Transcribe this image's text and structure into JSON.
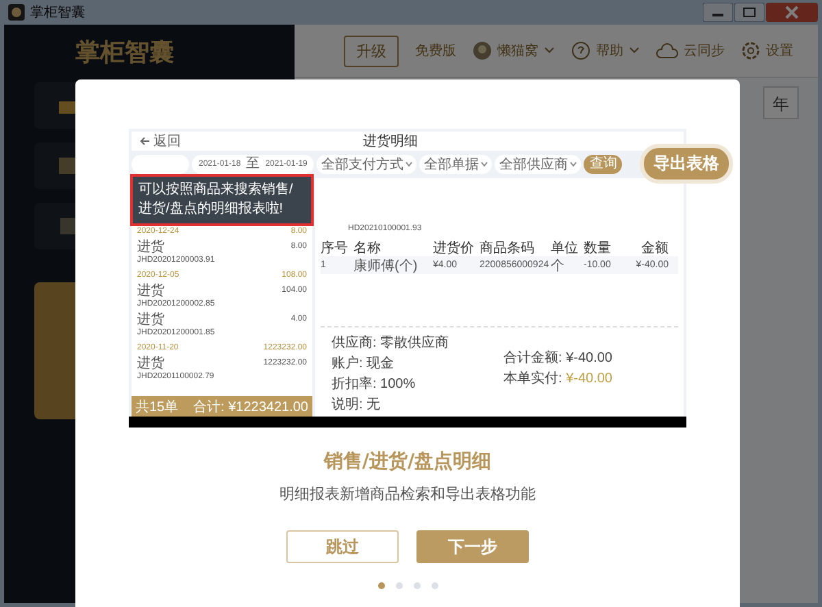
{
  "window": {
    "title": "掌柜智囊"
  },
  "header": {
    "upgrade": "升级",
    "edition": "免费版",
    "user": "懒猫窝",
    "help": "帮助",
    "sync": "云同步",
    "settings": "设置"
  },
  "background": {
    "logo": "掌柜智囊",
    "year_fragment": "年"
  },
  "dialog": {
    "preview": {
      "back": "返回",
      "title": "进货明细",
      "date_from": "2021-01-18",
      "date_sep": "至",
      "date_to": "2021-01-19",
      "filters": [
        "全部支付方式",
        "全部单据",
        "全部供应商"
      ],
      "query": "查询",
      "list": [
        {
          "kind": "date",
          "label": "2020-12-24",
          "amount": "8.00"
        },
        {
          "kind": "entry",
          "label": "进货",
          "amount": "8.00",
          "code": "JHD20201200003.91"
        },
        {
          "kind": "date",
          "label": "2020-12-05",
          "amount": "108.00"
        },
        {
          "kind": "entry",
          "label": "进货",
          "amount": "104.00",
          "code": "JHD20201200002.85"
        },
        {
          "kind": "entry",
          "label": "进货",
          "amount": "4.00",
          "code": "JHD20201200001.85"
        },
        {
          "kind": "date",
          "label": "2020-11-20",
          "amount": "1223232.00"
        },
        {
          "kind": "entry",
          "label": "进货",
          "amount": "1223232.00",
          "code": "JHD20201100002.79"
        }
      ],
      "list_footer": {
        "count": "共15单",
        "total": "合计: ¥1223421.00"
      },
      "order_no": "HD20210100001.93",
      "columns": [
        "序号",
        "名称",
        "进货价",
        "商品条码",
        "单位",
        "数量",
        "金额"
      ],
      "rows": [
        [
          "1",
          "康师傅(个)",
          "¥4.00",
          "2200856000924",
          "个",
          "-10.00",
          "¥-40.00"
        ]
      ],
      "info": [
        "供应商: 零散供应商",
        "账户: 现金",
        "折扣率: 100%",
        "说明: 无"
      ],
      "totals": [
        {
          "label": "合计金额:",
          "value": "¥-40.00",
          "highlight": false
        },
        {
          "label": "本单实付:",
          "value": "¥-40.00",
          "highlight": true
        }
      ]
    },
    "tooltip": "可以按照商品来搜索销售/进货/盘点的明细报表啦!",
    "export_button": "导出表格",
    "title": "销售/进货/盘点明细",
    "description": "明细报表新增商品检索和导出表格功能",
    "buttons": [
      {
        "label": "跳过",
        "kind": "secondary"
      },
      {
        "label": "下一步",
        "kind": "primary"
      }
    ],
    "pages": [
      {
        "selected": true
      },
      {
        "selected": false
      },
      {
        "selected": false
      },
      {
        "selected": false
      }
    ]
  }
}
